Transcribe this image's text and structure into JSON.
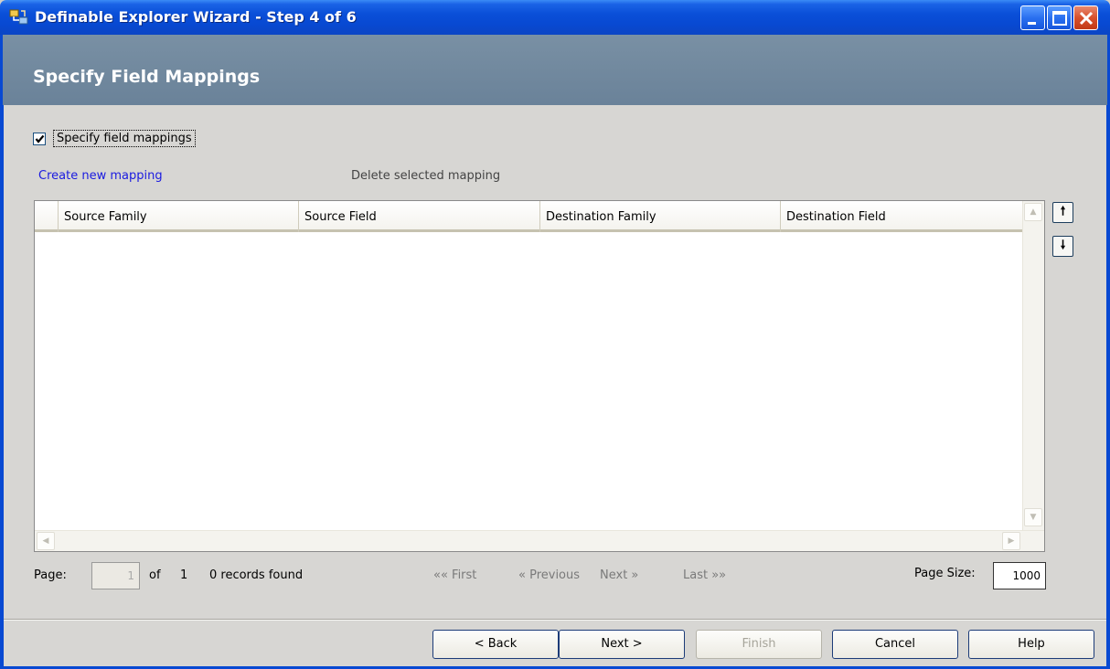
{
  "window": {
    "title": "Definable Explorer Wizard - Step 4 of 6",
    "icon": "explorer-wizard-app-icon",
    "controls": [
      "minimize-icon",
      "maximize-icon",
      "close-icon"
    ]
  },
  "header": {
    "title": "Specify Field Mappings"
  },
  "options": {
    "specify_checkbox": {
      "label": "Specify field mappings",
      "checked": true
    }
  },
  "links": {
    "create": "Create new mapping",
    "delete": "Delete selected mapping"
  },
  "grid": {
    "columns": [
      "Source Family",
      "Source Field",
      "Destination Family",
      "Destination Field"
    ],
    "rows": []
  },
  "reorder": {
    "up_icon": "arrow-up-icon",
    "down_icon": "arrow-down-icon",
    "up_glyph": "🠕",
    "down_glyph": "🠗"
  },
  "pager": {
    "page_label": "Page:",
    "page_value": "1",
    "of_label": "of",
    "total_pages": "1",
    "records": "0 records found",
    "first": "«« First",
    "previous": "« Previous",
    "next": "Next »",
    "last": "Last »»",
    "page_size_label": "Page Size:",
    "page_size_value": "1000"
  },
  "buttons": {
    "back": "< Back",
    "next": "Next >",
    "finish": "Finish",
    "cancel": "Cancel",
    "help": "Help"
  },
  "colors": {
    "titlebar": "#0849d2",
    "header_band": "#6f879d",
    "link": "#1a1ae0"
  }
}
